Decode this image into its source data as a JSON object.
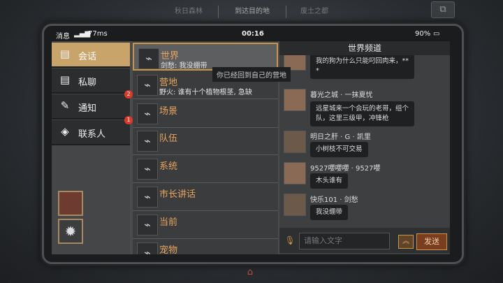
{
  "top": {
    "tabs": [
      "秋日森林",
      "到达目的地",
      "废土之都"
    ],
    "right_icon": "camera-icon"
  },
  "status_bar": {
    "left": "消息",
    "signal": "77ms",
    "time": "00:16",
    "battery": "90%"
  },
  "nav": {
    "items": [
      {
        "label": "会话",
        "icon": "chat-icon",
        "badge": ""
      },
      {
        "label": "私聊",
        "icon": "private-chat-icon",
        "badge": ""
      },
      {
        "label": "通知",
        "icon": "megaphone-icon",
        "badge": "2"
      },
      {
        "label": "联系人",
        "icon": "contacts-icon",
        "badge": "1"
      }
    ]
  },
  "channels": [
    {
      "name": "世界",
      "msg": "剑愁: 我没绷带"
    },
    {
      "name": "营地",
      "msg": "野火: 谁有十个植物根茎, 急缺"
    },
    {
      "name": "场景",
      "msg": ""
    },
    {
      "name": "队伍",
      "msg": ""
    },
    {
      "name": "系统",
      "msg": ""
    },
    {
      "name": "市长讲话",
      "msg": ""
    },
    {
      "name": "当前",
      "msg": ""
    },
    {
      "name": "宠物",
      "msg": ""
    }
  ],
  "tooltip": "你已经回到自己的营地",
  "world": {
    "title": "世界频道",
    "entries": [
      {
        "nick": "",
        "lines": [
          "我的狗为什么只能叼回肉来，**",
          "*"
        ]
      },
      {
        "nick": "暮光之城 · 一抹夏忧",
        "lines": [
          "远星城来一个会玩的老哥，组个",
          "队，这里三级甲，冲锋枪"
        ]
      },
      {
        "nick": "明日之肝 · G · 凯里",
        "lines": [
          "小树枝不可交易"
        ]
      },
      {
        "nick": "9527嚶嚶嚶 · 9527嚶",
        "lines": [
          "木头谁有"
        ]
      },
      {
        "nick": "快乐101 · 剑愁",
        "lines": [
          "我没绷带"
        ]
      }
    ]
  },
  "input": {
    "placeholder": "请输入文字",
    "send_label": "发送"
  }
}
